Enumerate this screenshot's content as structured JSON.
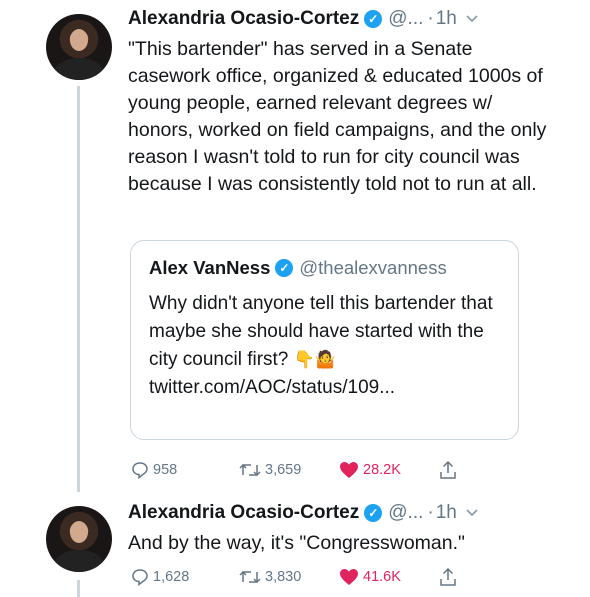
{
  "tweets": [
    {
      "author": {
        "name": "Alexandria Ocasio-Cortez",
        "verified_badge": "✓",
        "handle": "@...",
        "separator": "·",
        "time": "1h",
        "menu_icon": "chevron-down-icon"
      },
      "text": "\"This bartender\" has served in a Senate casework office, organized & educated 1000s of young people, earned relevant degrees w/ honors, worked on field campaigns, and the only reason I wasn't told to run for city council was because I was consistently told not to run at all.",
      "quoted_tweet": {
        "name": "Alex VanNess",
        "verified_badge": "✓",
        "handle": "@thealexvanness",
        "text_before_emoji": "Why didn't anyone tell this bartender that maybe she should have started with the city council first?",
        "emojis": "👇🤷",
        "link_text": "twitter.com/AOC/status/109..."
      },
      "stats": {
        "replies": "958",
        "retweets": "3,659",
        "likes": "28.2K"
      }
    },
    {
      "author": {
        "name": "Alexandria Ocasio-Cortez",
        "verified_badge": "✓",
        "handle": "@...",
        "separator": "·",
        "time": "1h",
        "menu_icon": "chevron-down-icon"
      },
      "text": "And by the way, it's \"Congresswoman.\"",
      "stats": {
        "replies": "1,628",
        "retweets": "3,830",
        "likes": "41.6K"
      }
    }
  ],
  "colors": {
    "text": "#14171a",
    "muted": "#657786",
    "verified": "#1da1f2",
    "like": "#e0245e",
    "border": "#ccd6dd"
  }
}
